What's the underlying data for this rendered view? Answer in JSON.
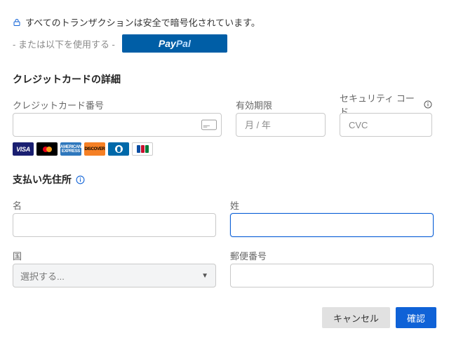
{
  "secure_message": "すべてのトランザクションは安全で暗号化されています。",
  "alt_prefix": "- または以下を使用する -",
  "paypal_label_a": "Pay",
  "paypal_label_b": "Pal",
  "card": {
    "section_title": "クレジットカードの詳細",
    "number_label": "クレジットカード番号",
    "number_value": "",
    "exp_label": "有効期限",
    "exp_placeholder": "月 / 年",
    "cvc_label": "セキュリティ コード",
    "cvc_placeholder": "CVC",
    "brands": [
      "visa",
      "mastercard",
      "amex",
      "discover",
      "diners",
      "jcb"
    ]
  },
  "billing": {
    "section_title": "支払い先住所",
    "first_label": "名",
    "last_label": "姓",
    "country_label": "国",
    "country_placeholder": "選択する...",
    "zip_label": "郵便番号"
  },
  "footer": {
    "cancel": "キャンセル",
    "confirm": "確認"
  }
}
